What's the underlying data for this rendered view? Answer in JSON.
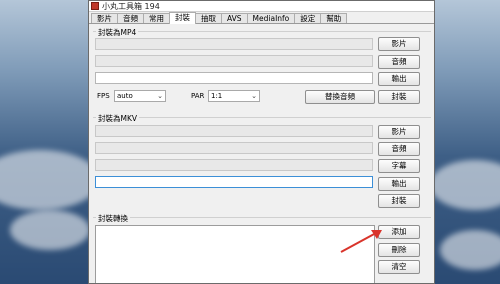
{
  "title": "小丸工具箱 194",
  "tabs": [
    "影片",
    "音頻",
    "常用",
    "封裝",
    "抽取",
    "AVS",
    "MediaInfo",
    "設定",
    "幫助"
  ],
  "active_tab": "封裝",
  "mp4": {
    "title": "封裝為MP4",
    "buttons": {
      "video": "影片",
      "audio": "音頻",
      "output": "輸出",
      "mux": "封裝",
      "replace_audio": "替換音頻"
    },
    "fps_label": "FPS",
    "fps_value": "auto",
    "par_label": "PAR",
    "par_value": "1:1"
  },
  "mkv": {
    "title": "封裝為MKV",
    "buttons": {
      "video": "影片",
      "audio": "音頻",
      "subtitle": "字幕",
      "output": "輸出",
      "mux": "封裝"
    }
  },
  "convert": {
    "title": "封裝轉換",
    "buttons": {
      "add": "添加",
      "delete": "刪除",
      "clear": "清空"
    }
  },
  "annotation_color": "#d9342b"
}
